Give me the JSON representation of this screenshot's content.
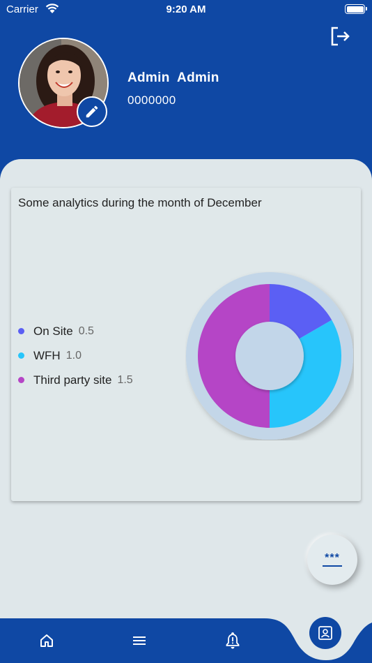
{
  "status_bar": {
    "carrier": "Carrier",
    "time": "9:20 AM"
  },
  "profile": {
    "name": "Admin  Admin",
    "id": "0000000"
  },
  "analytics": {
    "title": "Some analytics during the month of December",
    "chart_data": {
      "type": "pie",
      "categories": [
        "On Site",
        "WFH",
        "Third party site"
      ],
      "values": [
        0.5,
        1.0,
        1.5
      ],
      "value_labels": [
        "0.5",
        "1.0",
        "1.5"
      ],
      "colors": [
        "#5b5ff4",
        "#27c5fb",
        "#b545c6"
      ],
      "donut": true,
      "legend_position": "left"
    }
  },
  "fab": {
    "label": "***"
  },
  "nav": {
    "items": [
      "home-icon",
      "menu-icon",
      "bell-icon",
      "contact-icon"
    ]
  },
  "colors": {
    "primary": "#0f48a4",
    "background": "#dfe7ea"
  }
}
